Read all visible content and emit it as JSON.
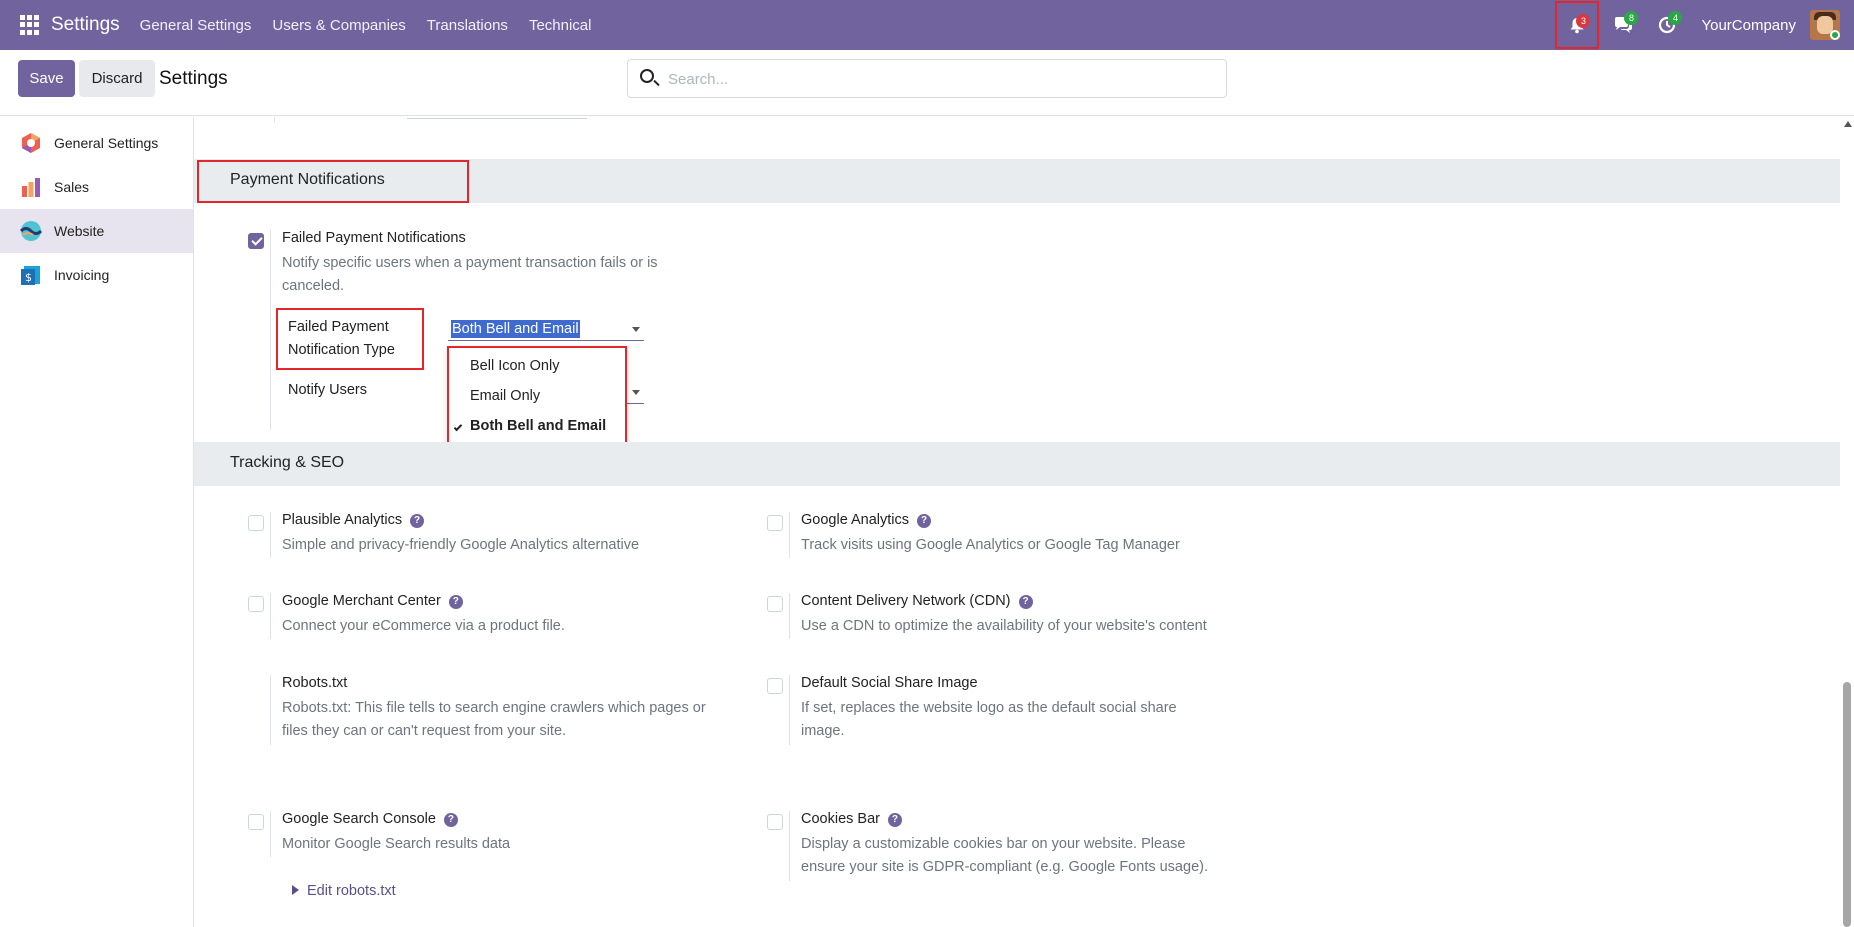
{
  "navbar": {
    "brand": "Settings",
    "menus": [
      "General Settings",
      "Users & Companies",
      "Translations",
      "Technical"
    ],
    "bell_count": "3",
    "chat_count": "8",
    "activity_count": "4",
    "company": "YourCompany"
  },
  "control": {
    "save_label": "Save",
    "discard_label": "Discard",
    "title": "Settings",
    "search_placeholder": "Search..."
  },
  "sidebar": {
    "items": [
      {
        "label": "General Settings",
        "icon": "general-settings-icon"
      },
      {
        "label": "Sales",
        "icon": "sales-icon"
      },
      {
        "label": "Website",
        "icon": "website-icon",
        "active": true
      },
      {
        "label": "Invoicing",
        "icon": "invoicing-icon"
      }
    ]
  },
  "payment": {
    "section_title": "Payment Notifications",
    "failed_label": "Failed Payment Notifications",
    "failed_desc": "Notify specific users when a payment transaction fails or is canceled.",
    "failed_checked": true,
    "type_label": "Failed Payment Notification Type",
    "type_value": "Both Bell and Email",
    "notify_users_label": "Notify Users",
    "options": [
      "Bell Icon Only",
      "Email Only",
      "Both Bell and Email"
    ],
    "selected_option": "Both Bell and Email"
  },
  "tracking": {
    "section_title": "Tracking & SEO",
    "settings": [
      {
        "label": "Plausible Analytics",
        "desc": "Simple and privacy-friendly Google Analytics alternative",
        "help": true
      },
      {
        "label": "Google Analytics",
        "desc": "Track visits using Google Analytics or Google Tag Manager",
        "help": true
      },
      {
        "label": "Google Merchant Center",
        "desc": "Connect your eCommerce via a product file.",
        "help": true
      },
      {
        "label": "Content Delivery Network (CDN)",
        "desc": "Use a CDN to optimize the availability of your website's content",
        "help": true
      },
      {
        "label": "Robots.txt",
        "desc": "Robots.txt: This file tells to search engine crawlers which pages or files they can or can't request from your site.",
        "link": "Edit robots.txt"
      },
      {
        "label": "Default Social Share Image",
        "desc": "If set, replaces the website logo as the default social share image."
      },
      {
        "label": "Google Search Console",
        "desc": "Monitor Google Search results data",
        "help": true
      },
      {
        "label": "Cookies Bar",
        "desc": "Display a customizable cookies bar on your website. Please ensure your site is GDPR-compliant (e.g. Google Fonts usage).",
        "help": true
      }
    ]
  },
  "colors": {
    "brand": "#71639e",
    "highlight_border": "#e3262a",
    "selection": "#3f6bd1"
  }
}
